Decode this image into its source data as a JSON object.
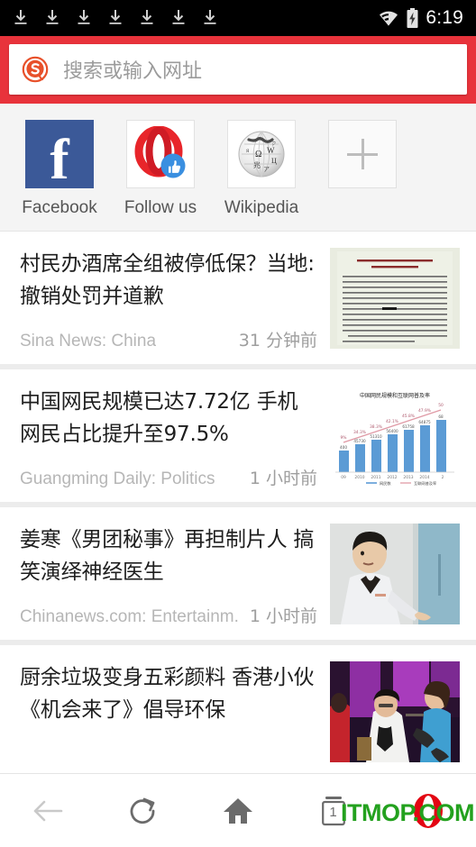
{
  "statusbar": {
    "download_icons": [
      "download-icon",
      "download-icon",
      "download-icon",
      "download-icon",
      "download-icon",
      "download-icon",
      "download-icon"
    ],
    "wifi_icon": "wifi-icon",
    "battery_icon": "battery-charging-icon",
    "time": "6:19",
    "background": "#000000",
    "text_color": "#ffffff"
  },
  "omnibar": {
    "engine_icon": "sogou-logo-icon",
    "placeholder": "搜索或输入网址",
    "value": "",
    "bar_background": "#e8333b",
    "field_background": "#ffffff"
  },
  "speed_dial": {
    "items": [
      {
        "label": "Facebook",
        "icon": "facebook-icon",
        "color": "#3b5998"
      },
      {
        "label": "Follow us",
        "icon": "opera-thumbsup-icon",
        "color": "#e8252a"
      },
      {
        "label": "Wikipedia",
        "icon": "wikipedia-icon",
        "color": "#cccccc"
      }
    ],
    "add_button": {
      "label": "",
      "icon": "plus-icon"
    },
    "background": "#f4f4f4"
  },
  "feed": {
    "items": [
      {
        "title": "村民办酒席全组被停低保？当地:撤销处罚并道歉",
        "source": "Sina News: China",
        "time": "31 分钟前",
        "thumb": "document-notice-thumbnail"
      },
      {
        "title": "中国网民规模已达7.72亿 手机网民占比提升至97.5%",
        "source": "Guangming Daily: Politics",
        "time": "1 小时前",
        "thumb": "bar-chart-thumbnail"
      },
      {
        "title": "姜寒《男团秘事》再担制片人 搞笑演绎神经医生",
        "source": "Chinanews.com: Entertainm.",
        "time": "1 小时前",
        "thumb": "man-labcoat-photo-thumbnail"
      },
      {
        "title": "厨余垃圾变身五彩颜料 香港小伙《机会来了》倡导环保",
        "source": "",
        "time": "",
        "thumb": "tv-studio-photo-thumbnail"
      }
    ]
  },
  "bottomnav": {
    "back": {
      "icon": "back-arrow-icon",
      "enabled": false
    },
    "reload": {
      "icon": "reload-icon"
    },
    "home": {
      "icon": "home-icon"
    },
    "tabs": {
      "icon": "tabs-icon",
      "count": "1"
    },
    "menu": {
      "icon": "opera-o-icon"
    }
  },
  "watermark": {
    "text": "ITMOP.COM",
    "color": "#23a11e"
  }
}
